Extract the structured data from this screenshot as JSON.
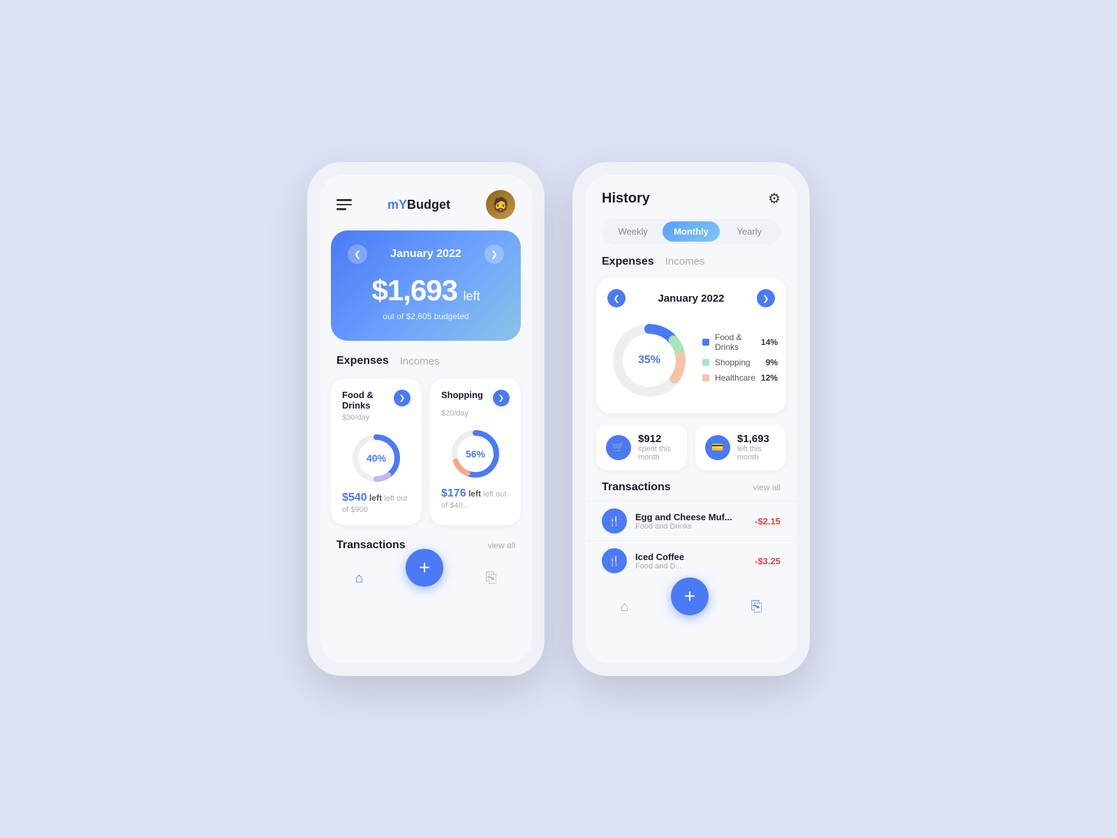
{
  "phone1": {
    "header": {
      "logo_my": "mY",
      "logo_budget": "Budget"
    },
    "budget_card": {
      "month": "January 2022",
      "amount": "$1,693",
      "left_label": "left",
      "subtitle": "out of $2,605 budgeted"
    },
    "tabs": {
      "active": "Expenses",
      "inactive": "Incomes"
    },
    "expense_cards": [
      {
        "title": "Food & Drinks",
        "subtitle": "$30/day",
        "percent": 40,
        "bottom_amount": "$540",
        "bottom_text": "left out of $900"
      },
      {
        "title": "Shopping",
        "subtitle": "$20/day",
        "percent": 56,
        "bottom_amount": "$176",
        "bottom_text": "left out of $40..."
      }
    ],
    "transactions": {
      "title": "Transactions",
      "view_all": "view all"
    },
    "bottom_nav": {
      "add_label": "+"
    }
  },
  "phone2": {
    "header": {
      "title": "History"
    },
    "period_toggle": {
      "options": [
        "Weekly",
        "Monthly",
        "Yearly"
      ],
      "active": "Monthly"
    },
    "tabs": {
      "active": "Expenses",
      "inactive": "Incomes"
    },
    "chart": {
      "month": "January 2022",
      "center_label": "35%",
      "legend": [
        {
          "name": "Food & Drinks",
          "percent": "14%",
          "color": "#4a7af5"
        },
        {
          "name": "Shopping",
          "percent": "9%",
          "color": "#a8e6b8"
        },
        {
          "name": "Healthcare",
          "percent": "12%",
          "color": "#f5c4a8"
        }
      ]
    },
    "stats": [
      {
        "amount": "$912",
        "label": "spent this month",
        "icon": "🛒"
      },
      {
        "amount": "$1,693",
        "label": "left this month",
        "icon": "💳"
      }
    ],
    "transactions": {
      "title": "Transactions",
      "view_all": "view all",
      "items": [
        {
          "name": "Egg and Cheese Muf...",
          "category": "Food and Drinks",
          "amount": "-$2.15"
        },
        {
          "name": "Iced Coffee",
          "category": "Food and D...",
          "amount": "-$3.25"
        }
      ]
    }
  }
}
